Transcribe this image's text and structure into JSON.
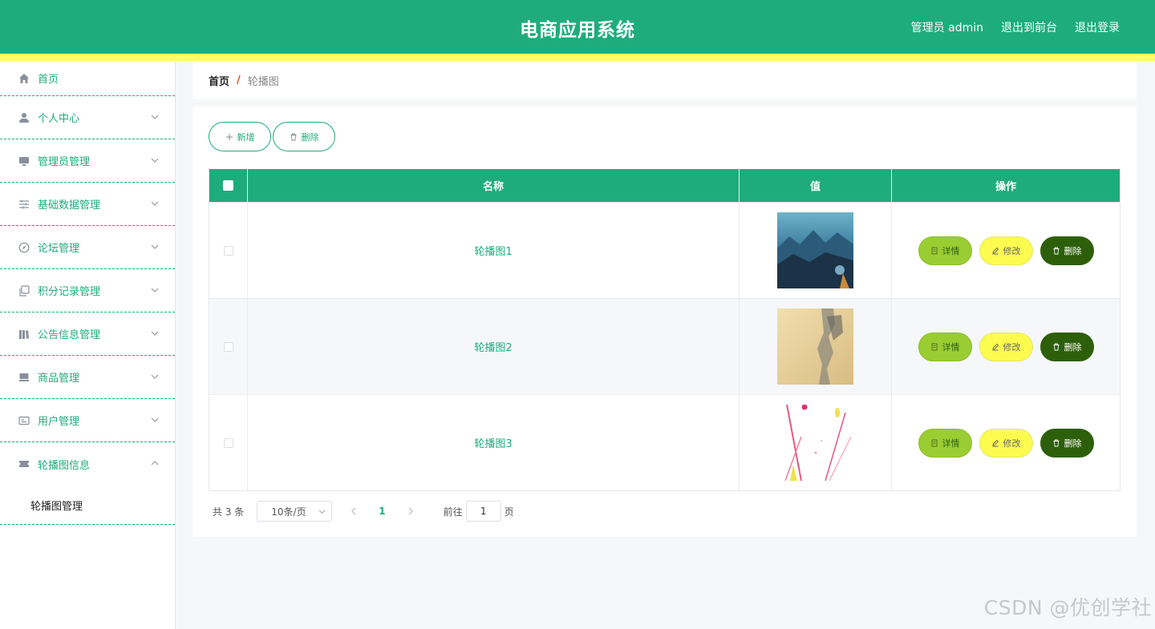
{
  "header": {
    "title": "电商应用系统",
    "user_label": "管理员 admin",
    "to_front": "退出到前台",
    "logout": "退出登录",
    "bg_color": "#1fac7c",
    "stripe_color": "#fcfb6a"
  },
  "sidebar": {
    "items": [
      {
        "label": "首页",
        "icon": "home-icon"
      },
      {
        "label": "个人中心",
        "icon": "user-icon"
      },
      {
        "label": "管理员管理",
        "icon": "monitor-icon"
      },
      {
        "label": "基础数据管理",
        "icon": "sliders-icon"
      },
      {
        "label": "论坛管理",
        "icon": "compass-icon"
      },
      {
        "label": "积分记录管理",
        "icon": "copy-icon"
      },
      {
        "label": "公告信息管理",
        "icon": "notice-icon"
      },
      {
        "label": "商品管理",
        "icon": "goods-icon"
      },
      {
        "label": "用户管理",
        "icon": "card-icon"
      },
      {
        "label": "轮播图信息",
        "icon": "ticket-icon"
      }
    ],
    "submenu": {
      "label": "轮播图管理"
    }
  },
  "breadcrumb": {
    "home": "首页",
    "separator": "/",
    "current": "轮播图"
  },
  "toolbar": {
    "add_label": "新增",
    "delete_label": "删除"
  },
  "table": {
    "columns": [
      "名称",
      "值",
      "操作"
    ],
    "rows": [
      {
        "name": "轮播图1",
        "image": "mountain-landscape"
      },
      {
        "name": "轮播图2",
        "image": "vintage-paper"
      },
      {
        "name": "轮播图3",
        "image": "pink-abstract"
      }
    ],
    "actions": {
      "detail": "详情",
      "edit": "修改",
      "delete": "删除"
    }
  },
  "pagination": {
    "total_text": "共 3 条",
    "page_size": "10条/页",
    "current_page": "1",
    "goto_prefix": "前往",
    "goto_value": "1",
    "goto_suffix": "页"
  },
  "watermark": "CSDN @优创学社"
}
